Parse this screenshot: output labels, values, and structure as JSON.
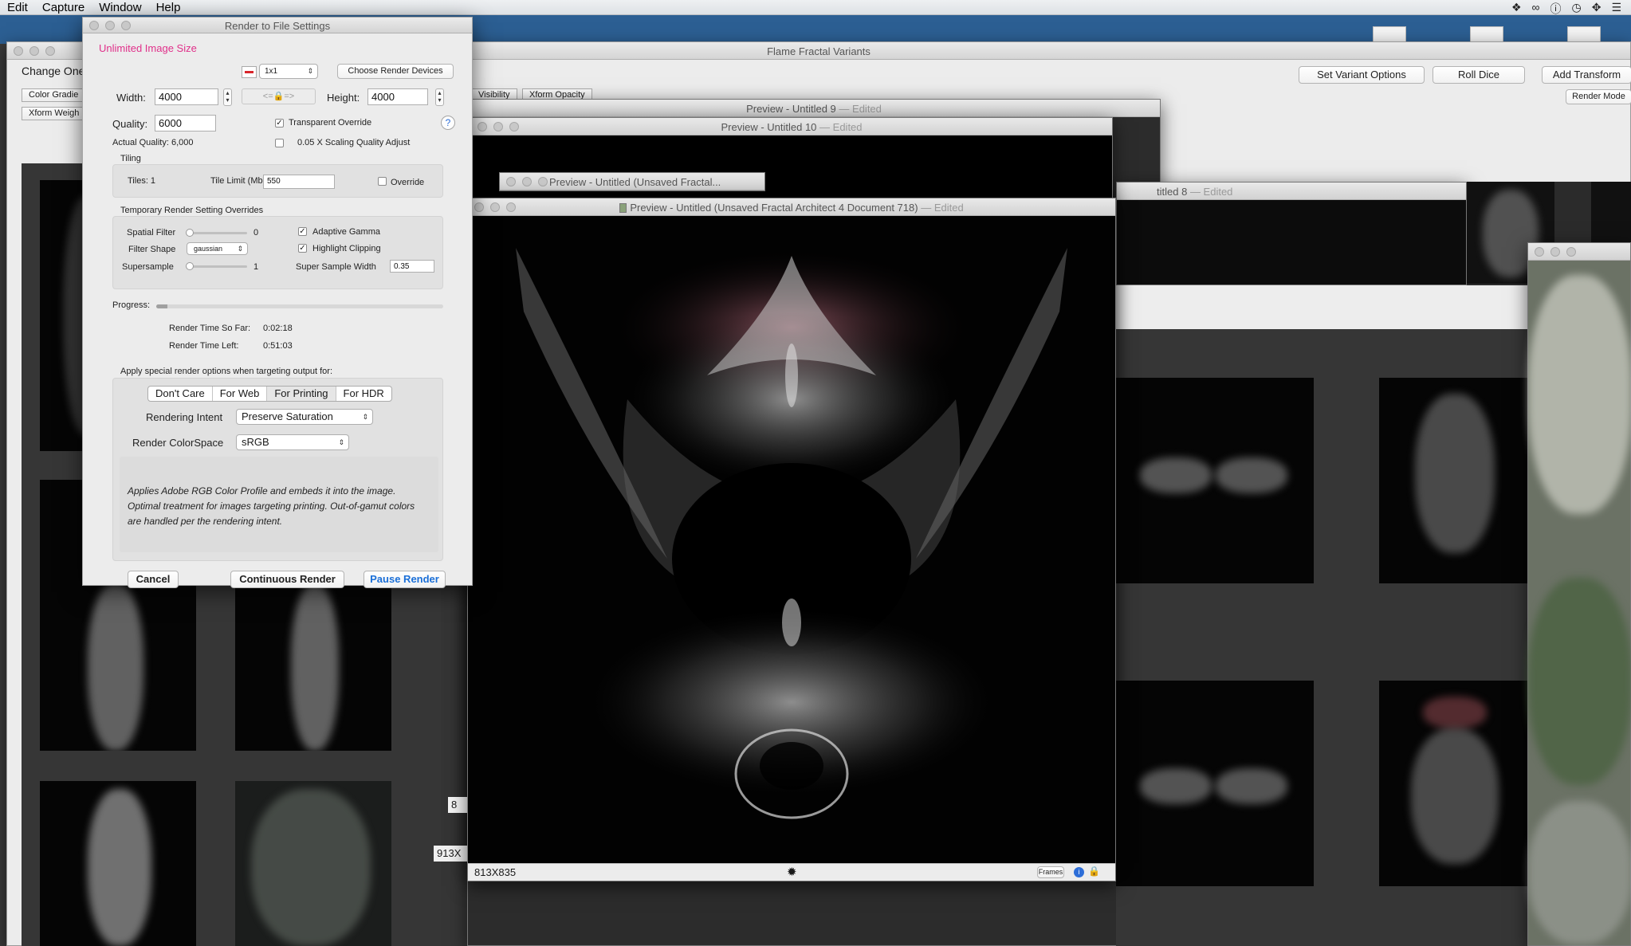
{
  "menubar": {
    "items": [
      "Edit",
      "Capture",
      "Window",
      "Help"
    ],
    "tray_icons": [
      "dropbox-icon",
      "creative-cloud-icon",
      "info-icon",
      "time-machine-icon",
      "move-icon",
      "menu-icon"
    ]
  },
  "variants_window": {
    "title": "Flame Fractal Variants",
    "change_one": "Change One",
    "tabs_left": [
      "Color Gradie",
      "Xform Weigh"
    ],
    "tabs_mid": [
      "Visibility",
      "Xform Opacity"
    ],
    "buttons": {
      "set_variant_options": "Set Variant Options",
      "roll_dice": "Roll Dice",
      "add_transform": "Add Transform",
      "render_mode": "Render Mode"
    }
  },
  "preview_windows": {
    "untitled9": {
      "title": "Preview - Untitled 9",
      "edited": "— Edited"
    },
    "untitled10": {
      "title": "Preview - Untitled 10",
      "edited": "— Edited"
    },
    "unsaved_small": {
      "title": "Preview - Untitled (Unsaved Fractal...",
      "edited": ""
    },
    "untitled8": {
      "title": "titled 8",
      "edited": "— Edited"
    },
    "main": {
      "title": "Preview - Untitled (Unsaved Fractal Architect 4 Document 718)",
      "edited": "— Edited",
      "size_label": "813X835",
      "frames_label": "Frames"
    },
    "side_label_1": "913X",
    "side_label_2": "8"
  },
  "dialog": {
    "title": "Render to File Settings",
    "unlimited": "Unlimited Image Size",
    "tile_popup": "1x1",
    "choose_devices": "Choose Render Devices",
    "width_label": "Width:",
    "width_value": "4000",
    "link_symbol": "<=🔒=>",
    "height_label": "Height:",
    "height_value": "4000",
    "quality_label": "Quality:",
    "quality_value": "6000",
    "transparent_override": "Transparent Override",
    "actual_quality": "Actual Quality: 6,000",
    "scaling_adjust": "0.05 X Scaling Quality Adjust",
    "help": "?",
    "tiling_label": "Tiling",
    "tiles": "Tiles:  1",
    "tile_limit_label": "Tile Limit (Mb):",
    "tile_limit_value": "550",
    "override": "Override",
    "temp_overrides": "Temporary Render  Setting Overrides",
    "spatial_filter": "Spatial Filter",
    "spatial_filter_value": "0",
    "adaptive_gamma": "Adaptive Gamma",
    "filter_shape": "Filter Shape",
    "filter_shape_value": "gaussian",
    "highlight_clipping": "Highlight Clipping",
    "supersample": "Supersample",
    "supersample_value": "1",
    "super_sample_width": "Super Sample Width",
    "super_sample_width_value": "0.35",
    "progress": "Progress:",
    "progress_fraction": 0.04,
    "render_time_so_far_label": "Render Time So Far:",
    "render_time_so_far": "0:02:18",
    "render_time_left_label": "Render Time Left:",
    "render_time_left": "0:51:03",
    "special_options": "Apply special render options when targeting output for:",
    "targets": [
      "Don't Care",
      "For Web",
      "For Printing",
      "For HDR"
    ],
    "rendering_intent_label": "Rendering Intent",
    "rendering_intent_value": "Preserve Saturation",
    "colorspace_label": "Render ColorSpace",
    "colorspace_value": "sRGB",
    "description": "Applies Adobe RGB Color Profile and embeds it into the image. Optimal treatment for images targeting printing. Out-of-gamut colors are handled per the rendering intent.",
    "cancel": "Cancel",
    "continuous": "Continuous Render",
    "pause": "Pause Render"
  },
  "colors": {
    "accent_pink": "#e0308a",
    "accent_blue": "#1a6fd8",
    "desktop_blue": "#2c5f93"
  }
}
